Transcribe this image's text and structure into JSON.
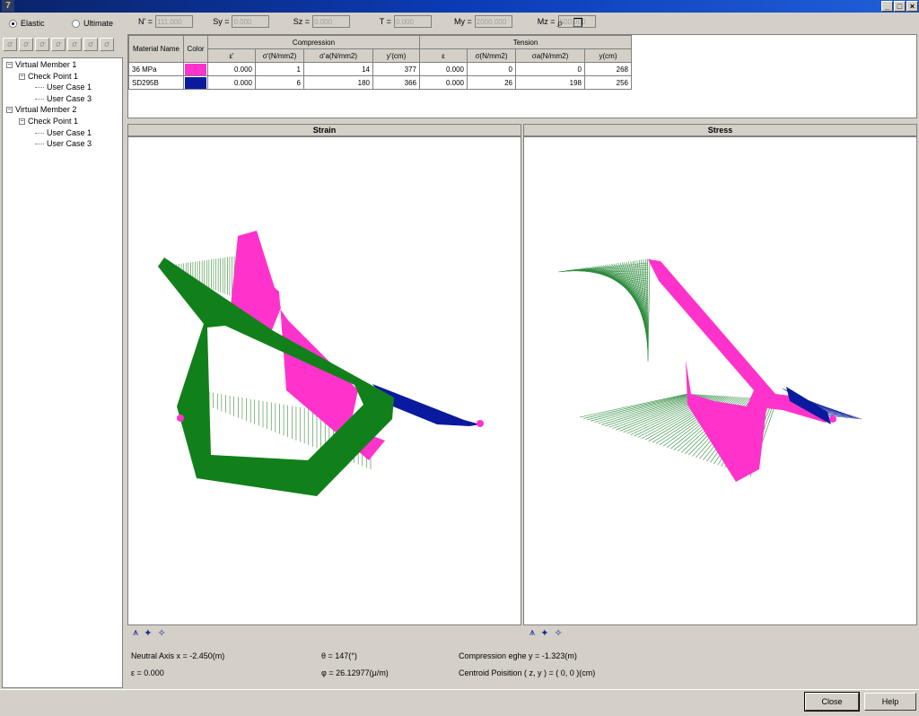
{
  "window": {
    "app_icon": "7",
    "controls": [
      "_",
      "□",
      "×"
    ]
  },
  "mode": {
    "options": [
      "Elastic",
      "Ultimate"
    ],
    "selected": "Elastic"
  },
  "sigma_buttons": [
    "σ",
    "σ",
    "σ",
    "σ",
    "σ",
    "σ",
    "σ"
  ],
  "tree": [
    {
      "label": "Virtual Member 1",
      "level": 0,
      "expander": "−"
    },
    {
      "label": "Check Point  1",
      "level": 1,
      "expander": "−"
    },
    {
      "label": "User Case 1",
      "level": 2
    },
    {
      "label": "User Case 3",
      "level": 2
    },
    {
      "label": "Virtual Member 2",
      "level": 0,
      "expander": "−"
    },
    {
      "label": "Check Point  1",
      "level": 1,
      "expander": "−"
    },
    {
      "label": "User Case 1",
      "level": 2
    },
    {
      "label": "User Case 3",
      "level": 2
    }
  ],
  "toolbar": {
    "fields": [
      {
        "label": "N' =",
        "value": "111.000"
      },
      {
        "label": "Sy =",
        "value": "0.000"
      },
      {
        "label": "Sz =",
        "value": "0.000"
      },
      {
        "label": "T =",
        "value": "0.000"
      },
      {
        "label": "My =",
        "value": "2000.000"
      },
      {
        "label": "Mz =",
        "value": "500.000"
      }
    ],
    "icons": [
      "zoom-icon",
      "copy-icon"
    ]
  },
  "table": {
    "group_headers": {
      "compression": "Compression",
      "tension": "Tension"
    },
    "col_headers": {
      "material": "Material Name",
      "color": "Color",
      "c_eps": "ε'",
      "c_sig": "σ'(N/mm2)",
      "c_siga": "σ'a(N/mm2)",
      "c_y": "y'(cm)",
      "t_eps": "ε",
      "t_sig": "σ(N/mm2)",
      "t_siga": "σa(N/mm2)",
      "t_y": "y(cm)"
    },
    "rows": [
      {
        "material": "36 MPa",
        "color": "#ff33cc",
        "c_eps": "0.000",
        "c_sig": "1",
        "c_siga": "14",
        "c_y": "377",
        "t_eps": "0.000",
        "t_sig": "0",
        "t_siga": "0",
        "t_y": "268"
      },
      {
        "material": "SD295B",
        "color": "#0a1a9e",
        "c_eps": "0.000",
        "c_sig": "6",
        "c_siga": "180",
        "c_y": "366",
        "t_eps": "0.000",
        "t_sig": "26",
        "t_siga": "198",
        "t_y": "256"
      }
    ]
  },
  "panels": {
    "strain_title": "Strain",
    "stress_title": "Stress",
    "tool_icons": [
      "⩚",
      "✦",
      "✧"
    ]
  },
  "info": {
    "neutral_axis": "Neutral Axis x = -2.450(m)",
    "theta": "θ = 147(°)",
    "compression_edge": "Compression eghe y = -1.323(m)",
    "epsilon": "ε = 0.000",
    "phi": "φ = 26.12977(μ/m)",
    "centroid": "Centroid Poisition ( z, y ) = ( 0, 0 )(cm)"
  },
  "buttons": {
    "close": "Close",
    "help": "Help"
  },
  "colors": {
    "concrete": "#ff33cc",
    "steel": "#0a1a9e",
    "section": "#12801a"
  }
}
